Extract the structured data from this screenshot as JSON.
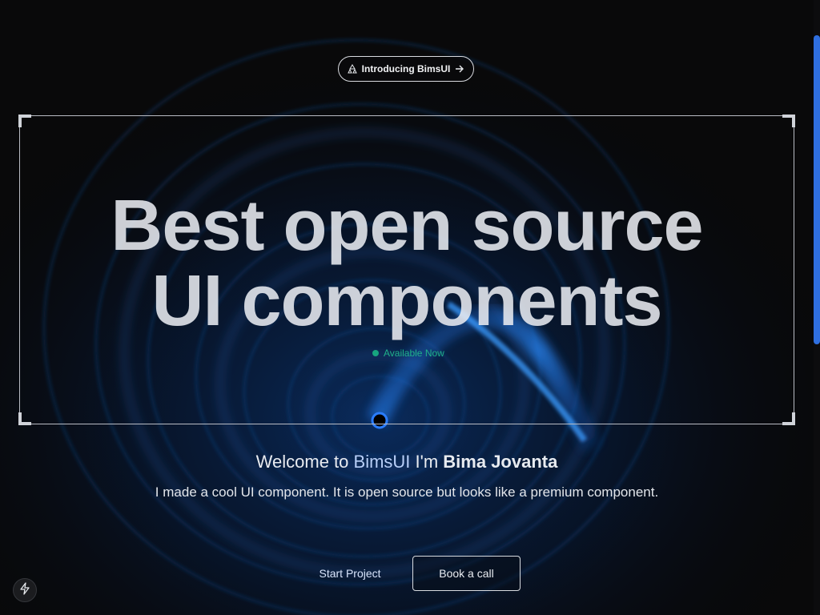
{
  "intro_pill": {
    "label": "Introducing BimsUI",
    "icon": "triangle-shapes-icon",
    "arrow_icon": "arrow-right-icon"
  },
  "hero": {
    "headline_line1": "Best open source",
    "headline_line2": "UI components",
    "status": "Available Now"
  },
  "welcome": {
    "prefix": "Welcome to ",
    "brand": "BimsUI",
    "middle": " I'm ",
    "name": "Bima Jovanta"
  },
  "tagline": "I made a cool UI component. It is open source but looks like a premium component.",
  "actions": {
    "start_label": "Start Project",
    "call_label": "Book a call"
  },
  "floating_button": {
    "icon": "lightning-bolt-icon"
  },
  "colors": {
    "background": "#09090a",
    "accent_blue": "#2f6fe0",
    "status_green": "#17a57f"
  }
}
